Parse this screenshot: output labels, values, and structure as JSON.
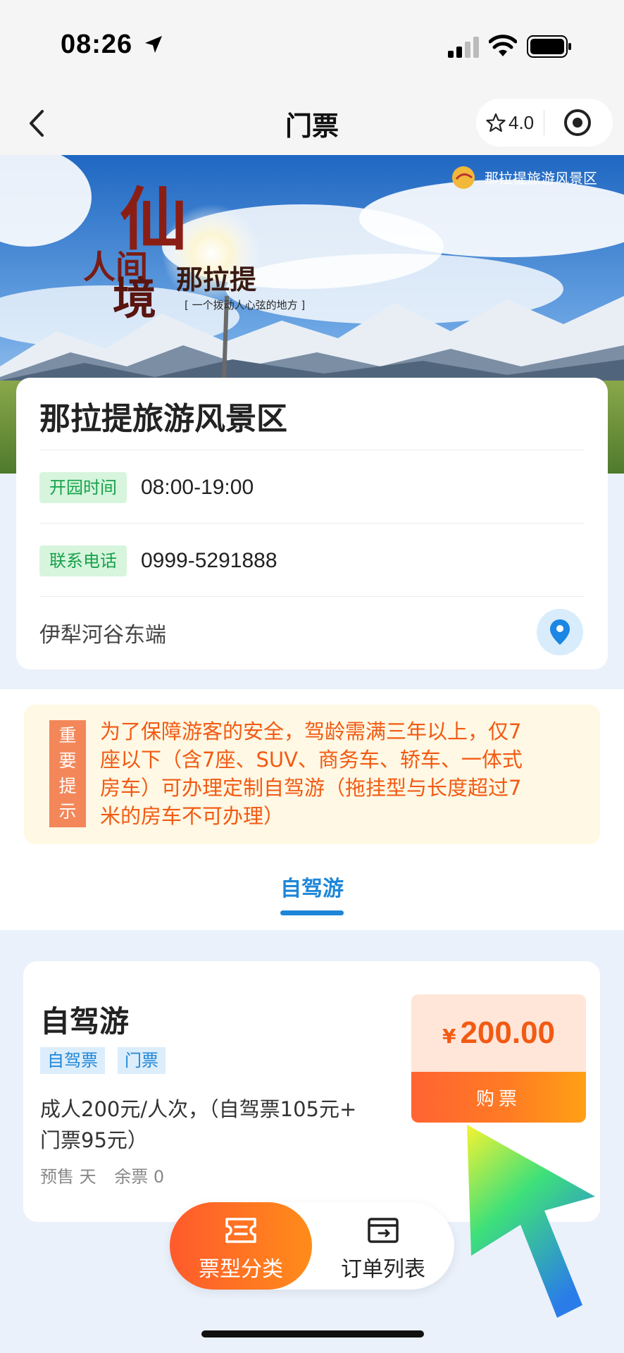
{
  "status_bar": {
    "time": "08:26"
  },
  "nav": {
    "title": "门票",
    "rating": "4.0"
  },
  "banner": {
    "calligraphy": [
      "人间",
      "仙",
      "境",
      "那拉提"
    ],
    "slogan": "[ 一个拨动人心弦的地方 ]",
    "logo_text": "那拉提旅游风景区"
  },
  "scenic": {
    "name": "那拉提旅游风景区",
    "hours_label": "开园时间",
    "hours": "08:00-19:00",
    "phone_label": "联系电话",
    "phone": "0999-5291888",
    "address": "伊犁河谷东端"
  },
  "notice": {
    "tag": [
      "重",
      "要",
      "提",
      "示"
    ],
    "lines": [
      "为了保障游客的安全，驾龄需满三年以上，仅7",
      "座以下（含7座、SUV、商务车、轿车、一体式",
      "房车）可办理定制自驾游（拖挂型与长度超过7",
      "米的房车不可办理）"
    ]
  },
  "tabs": {
    "active": "自驾游"
  },
  "ticket": {
    "title": "自驾游",
    "tags": [
      "自驾票",
      "门票"
    ],
    "desc_lines": [
      "成人200元/人次，（自驾票105元+",
      "门票95元）"
    ],
    "presale": "预售 天",
    "remaining": "余票 0",
    "currency": "¥",
    "price": "200.00",
    "buy_label": "购票"
  },
  "bottom_bar": {
    "types_label": "票型分类",
    "orders_label": "订单列表"
  },
  "colors": {
    "accent_blue": "#1e86d8",
    "accent_orange": "#f25a13",
    "tag_green": "#17a24a",
    "page_bg": "#eaf1fb"
  },
  "icons": [
    "location-arrow-icon",
    "cellular-icon",
    "wifi-icon",
    "battery-icon",
    "back-chevron-icon",
    "star-icon",
    "target-icon",
    "map-pin-icon",
    "ticket-icon",
    "wallet-icon",
    "cursor-arrow-icon"
  ]
}
